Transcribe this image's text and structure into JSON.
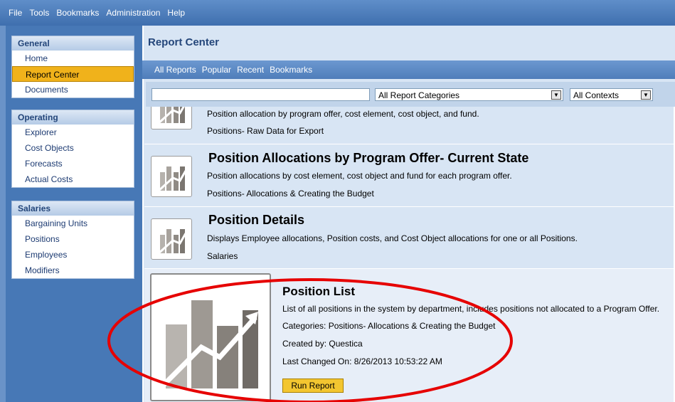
{
  "menu": [
    "File",
    "Tools",
    "Bookmarks",
    "Administration",
    "Help"
  ],
  "sidebar": {
    "groups": [
      {
        "title": "General",
        "items": [
          "Home",
          "Report Center",
          "Documents"
        ],
        "active": "Report Center"
      },
      {
        "title": "Operating",
        "items": [
          "Explorer",
          "Cost Objects",
          "Forecasts",
          "Actual Costs"
        ]
      },
      {
        "title": "Salaries",
        "items": [
          "Bargaining Units",
          "Positions",
          "Employees",
          "Modifiers"
        ]
      }
    ]
  },
  "main": {
    "title": "Report Center",
    "tabs": [
      "All Reports",
      "Popular",
      "Recent",
      "Bookmarks"
    ],
    "search_value": "",
    "category_select": "All Report Categories",
    "context_select": "All Contexts"
  },
  "reports": [
    {
      "title": "",
      "description": "Position allocation by program offer, cost element, cost object, and fund.",
      "category": "Positions- Raw Data for Export"
    },
    {
      "title": "Position Allocations by Program Offer- Current State",
      "description": "Position allocations by cost element, cost object and fund for each program offer.",
      "category": "Positions- Allocations & Creating the Budget"
    },
    {
      "title": "Position Details",
      "description": "Displays Employee allocations, Position costs, and Cost Object allocations for one or all Positions.",
      "category": "Salaries"
    }
  ],
  "selected_report": {
    "title": "Position List",
    "description": "List of all positions in the system by department, includes positions not allocated to a Program Offer.",
    "categories": "Categories: Positions- Allocations & Creating the Budget",
    "created_by": "Created by: Questica",
    "last_changed": "Last Changed On: 8/26/2013 10:53:22 AM",
    "run_label": "Run Report"
  },
  "colors": {
    "highlight": "#e60000",
    "active": "#f0b21b",
    "accent": "#4778b6"
  }
}
